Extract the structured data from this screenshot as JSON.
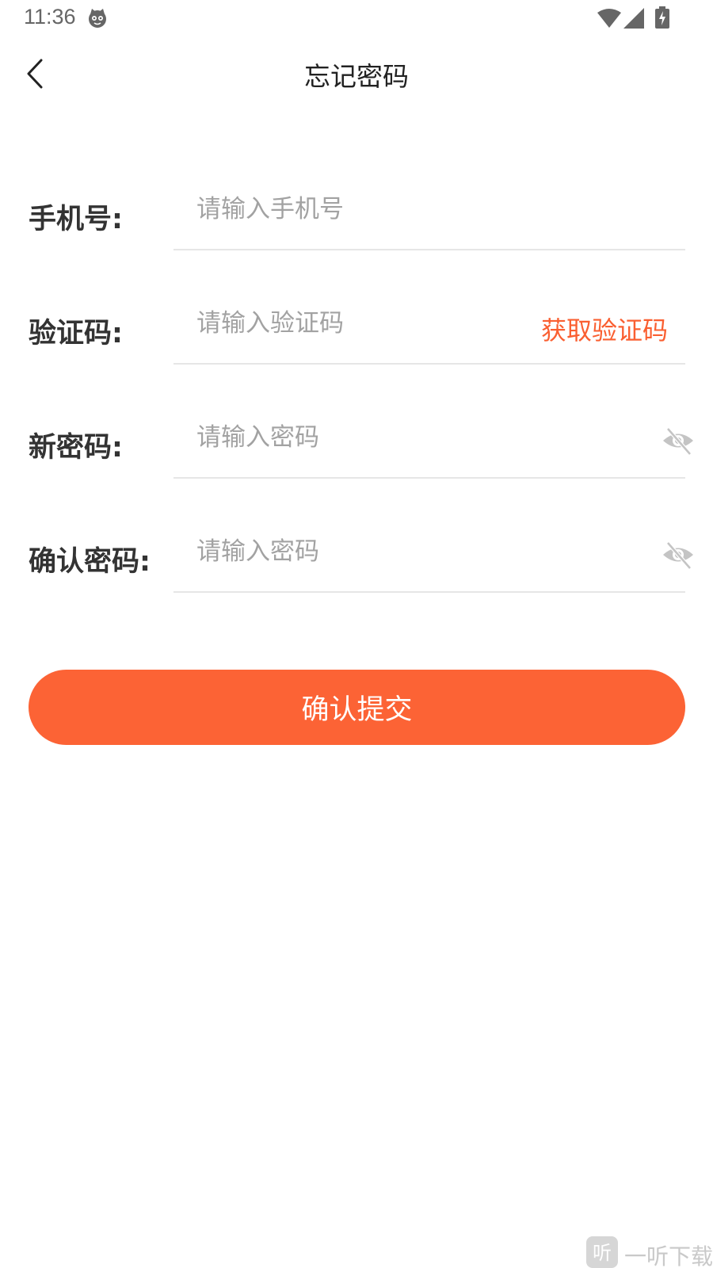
{
  "status_bar": {
    "time": "11:36",
    "app_icon": "cat-face-icon",
    "wifi_icon": "wifi-icon",
    "signal_icon": "cellular-signal-icon",
    "battery_icon": "battery-charging-icon"
  },
  "nav": {
    "back_icon": "chevron-left-icon",
    "title": "忘记密码"
  },
  "form": {
    "phone": {
      "label": "手机号:",
      "placeholder": "请输入手机号",
      "value": ""
    },
    "code": {
      "label": "验证码:",
      "placeholder": "请输入验证码",
      "value": "",
      "get_code_label": "获取验证码"
    },
    "new_password": {
      "label": "新密码:",
      "placeholder": "请输入密码",
      "value": "",
      "toggle_icon": "eye-off-icon"
    },
    "confirm_password": {
      "label": "确认密码:",
      "placeholder": "请输入密码",
      "value": "",
      "toggle_icon": "eye-off-icon"
    }
  },
  "submit": {
    "label": "确认提交"
  },
  "watermark": {
    "text": "一听下载",
    "logo_icon": "ting-logo-icon"
  },
  "colors": {
    "accent": "#fc6335",
    "accent_text": "#fa5f31",
    "divider": "#e6e6e6",
    "placeholder": "#a2a2a2",
    "label": "#333333"
  }
}
